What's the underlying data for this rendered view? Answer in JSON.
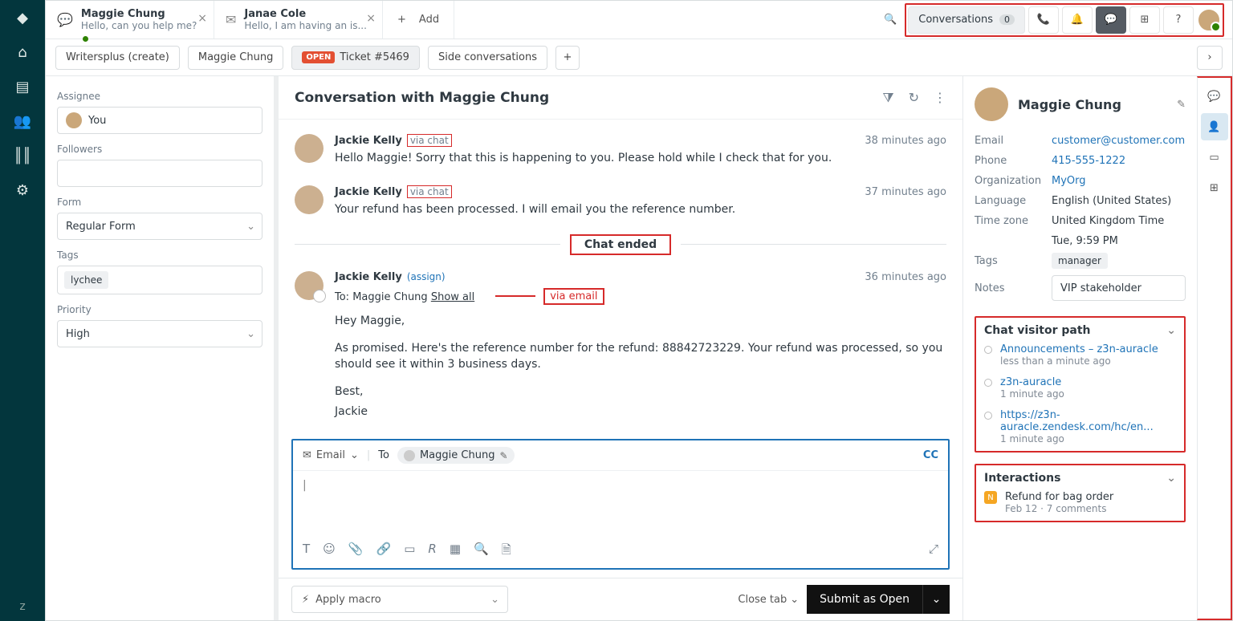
{
  "tabs": [
    {
      "title": "Maggie Chung",
      "subtitle": "Hello, can you help me?",
      "icon": "chat",
      "active": true
    },
    {
      "title": "Janae Cole",
      "subtitle": "Hello, I am having an is...",
      "icon": "mail"
    }
  ],
  "addTab": "Add",
  "headerRight": {
    "conversations": "Conversations",
    "convCount": "0"
  },
  "crumbs": {
    "org": "Writersplus (create)",
    "requester": "Maggie Chung",
    "openBadge": "OPEN",
    "ticket": "Ticket #5469",
    "sideConv": "Side conversations"
  },
  "sidebar": {
    "assigneeLbl": "Assignee",
    "assigneeVal": "You",
    "followersLbl": "Followers",
    "formLbl": "Form",
    "formVal": "Regular Form",
    "tagsLbl": "Tags",
    "tagVal": "lychee",
    "priorityLbl": "Priority",
    "priorityVal": "High"
  },
  "conversation": {
    "title": "Conversation with Maggie Chung",
    "msgs": [
      {
        "name": "Jackie Kelly",
        "via": "via chat",
        "time": "38 minutes ago",
        "text": "Hello Maggie! Sorry that this is happening to you. Please hold while I check that for you."
      },
      {
        "name": "Jackie Kelly",
        "via": "via chat",
        "time": "37 minutes ago",
        "text": "Your refund has been processed. I will email you the reference number."
      }
    ],
    "chatEnded": "Chat ended",
    "emailMsg": {
      "name": "Jackie Kelly",
      "assign": "(assign)",
      "time": "36 minutes ago",
      "to": "To: Maggie Chung",
      "showAll": "Show all",
      "annot": "via email",
      "l1": "Hey Maggie,",
      "l2": "As promised. Here's the reference number for the refund: 88842723229. Your refund was processed, so you should see it within 3 business days.",
      "l3": "Best,",
      "l4": "Jackie"
    }
  },
  "composer": {
    "channel": "Email",
    "toLbl": "To",
    "recip": "Maggie Chung",
    "cc": "CC",
    "cursor": "|"
  },
  "bottom": {
    "macro": "Apply macro",
    "closeTab": "Close tab",
    "submit": "Submit as Open"
  },
  "context": {
    "name": "Maggie Chung",
    "fields": {
      "emailLbl": "Email",
      "email": "customer@customer.com",
      "phoneLbl": "Phone",
      "phone": "415-555-1222",
      "orgLbl": "Organization",
      "org": "MyOrg",
      "langLbl": "Language",
      "lang": "English (United States)",
      "tzLbl": "Time zone",
      "tz": "United Kingdom Time",
      "tz2": "Tue, 9:59 PM",
      "tagsLbl": "Tags",
      "tag": "manager",
      "notesLbl": "Notes",
      "notes": "VIP stakeholder"
    },
    "path": {
      "title": "Chat visitor path",
      "items": [
        {
          "t": "Announcements – z3n-auracle",
          "s": "less than a minute ago"
        },
        {
          "t": "z3n-auracle",
          "s": "1 minute ago"
        },
        {
          "t": "https://z3n-auracle.zendesk.com/hc/en...",
          "s": "1 minute ago"
        }
      ]
    },
    "inter": {
      "title": "Interactions",
      "t": "Refund for bag order",
      "s": "Feb 12 · 7 comments"
    }
  }
}
